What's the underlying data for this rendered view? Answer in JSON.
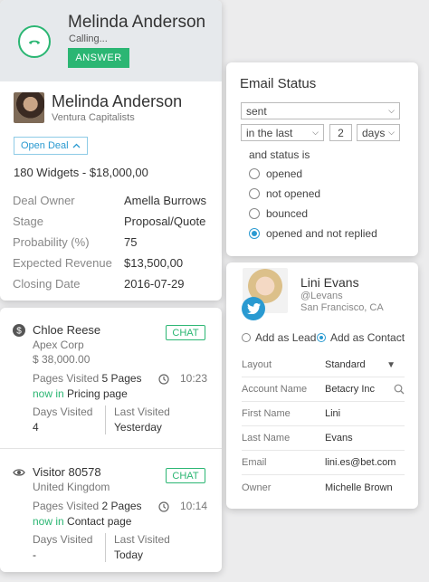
{
  "call": {
    "caller_name": "Melinda Anderson",
    "status": "Calling...",
    "answer_label": "ANSWER",
    "contact_name": "Melinda Anderson",
    "contact_company": "Ventura Capitalists",
    "open_deal_label": "Open Deal",
    "deal_title": "180 Widgets - $18,000,00",
    "deal_fields": [
      {
        "label": "Deal Owner",
        "value": "Amella Burrows"
      },
      {
        "label": "Stage",
        "value": "Proposal/Quote"
      },
      {
        "label": "Probability (%)",
        "value": "75"
      },
      {
        "label": "Expected Revenue",
        "value": "$13,500,00"
      },
      {
        "label": "Closing Date",
        "value": "2016-07-29"
      }
    ]
  },
  "email": {
    "title": "Email Status",
    "status_select": "sent",
    "period_select": "in the last",
    "count_value": "2",
    "unit_select": "days",
    "and_status_label": "and status is",
    "options": [
      {
        "label": "opened",
        "selected": false
      },
      {
        "label": "not opened",
        "selected": false
      },
      {
        "label": "bounced",
        "selected": false
      },
      {
        "label": "opened and not replied",
        "selected": true
      }
    ]
  },
  "visitors": [
    {
      "name": "Chloe Reese",
      "company": "Apex Corp",
      "amount": "$ 38,000.00",
      "chat_label": "CHAT",
      "pages_visited_label": "Pages Visited",
      "pages_visited_value": "5 Pages",
      "now_in_label": "now in",
      "now_in_page": "Pricing page",
      "time": "10:23",
      "days_visited_label": "Days Visited",
      "days_visited_value": "4",
      "last_visited_label": "Last Visited",
      "last_visited_value": "Yesterday",
      "icon": "dollar-icon"
    },
    {
      "name": "Visitor 80578",
      "company": "United Kingdom",
      "chat_label": "CHAT",
      "pages_visited_label": "Pages Visited",
      "pages_visited_value": "2 Pages",
      "now_in_label": "now in",
      "now_in_page": "Contact page",
      "time": "10:14",
      "days_visited_label": "Days Visited",
      "days_visited_value": "-",
      "last_visited_label": "Last Visited",
      "last_visited_value": "Today",
      "icon": "eye-icon"
    }
  ],
  "lead": {
    "name": "Lini Evans",
    "handle": "@Levans",
    "location": "San Francisco, CA",
    "add_as_lead": "Add as Lead",
    "add_as_contact": "Add as Contact",
    "fields": [
      {
        "label": "Layout",
        "value": "Standard"
      },
      {
        "label": "Account Name",
        "value": "Betacry Inc"
      },
      {
        "label": "First Name",
        "value": "Lini"
      },
      {
        "label": "Last Name",
        "value": "Evans"
      },
      {
        "label": "Email",
        "value": "lini.es@bet.com"
      },
      {
        "label": "Owner",
        "value": "Michelle Brown"
      }
    ]
  },
  "colors": {
    "accent_green": "#2bb673",
    "accent_blue": "#2a9ad1"
  }
}
